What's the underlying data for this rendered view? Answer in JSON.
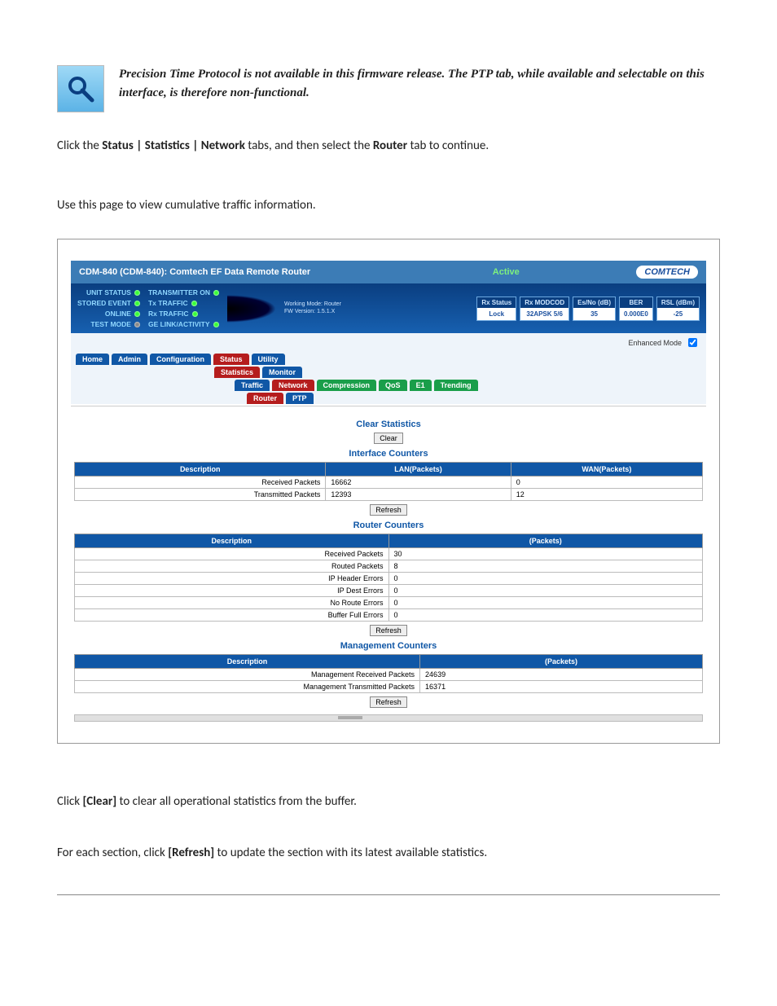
{
  "note": "Precision Time Protocol is not available in this firmware release. The PTP tab, while available and selectable on this interface, is therefore non-functional.",
  "intro1_pre": "Click the ",
  "intro1_bold": "Status | Statistics | Network",
  "intro1_mid": " tabs, and then select the ",
  "intro1_bold2": "Router",
  "intro1_post": " tab to continue.",
  "intro2": "Use this page to view cumulative traffic information.",
  "outro1_pre": "Click ",
  "outro1_bold": "[Clear]",
  "outro1_post": " to clear all operational statistics from the buffer.",
  "outro2_pre": "For each section, click ",
  "outro2_bold": "[Refresh]",
  "outro2_post": " to update the section with its latest available statistics.",
  "ss": {
    "title": "CDM-840 (CDM-840): Comtech EF Data Remote Router",
    "active": "Active",
    "brand": "COMTECH",
    "status_left": [
      {
        "label": "UNIT STATUS"
      },
      {
        "label": "STORED EVENT"
      },
      {
        "label": "ONLINE"
      },
      {
        "label": "TEST MODE"
      }
    ],
    "status_right": [
      {
        "label": "TRANSMITTER ON"
      },
      {
        "label": "Tx TRAFFIC"
      },
      {
        "label": "Rx TRAFFIC"
      },
      {
        "label": "GE LINK/ACTIVITY"
      }
    ],
    "wm1": "Working Mode: Router",
    "wm2": "FW Version: 1.5.1.X",
    "rx": [
      {
        "hdr": "Rx Status",
        "val": "Lock"
      },
      {
        "hdr": "Rx MODCOD",
        "val": "32APSK 5/6"
      },
      {
        "hdr": "Es/No (dB)",
        "val": "35"
      },
      {
        "hdr": "BER",
        "val": "0.000E0"
      },
      {
        "hdr": "RSL (dBm)",
        "val": "-25"
      }
    ],
    "enhanced": "Enhanced Mode",
    "nav1": [
      "Home",
      "Admin",
      "Configuration",
      "Status",
      "Utility"
    ],
    "nav1_sel": "Status",
    "nav2": [
      "Statistics",
      "Monitor"
    ],
    "nav2_sel": "Statistics",
    "nav3": [
      "Traffic",
      "Network",
      "Compression",
      "QoS",
      "E1",
      "Trending"
    ],
    "nav3_sel": "Network",
    "nav4": [
      "Router",
      "PTP"
    ],
    "nav4_sel": "Router",
    "sec_clear": "Clear Statistics",
    "btn_clear": "Clear",
    "sec_if": "Interface Counters",
    "if_headers": [
      "Description",
      "LAN(Packets)",
      "WAN(Packets)"
    ],
    "if_rows": [
      {
        "d": "Received Packets",
        "l": "16662",
        "w": "0"
      },
      {
        "d": "Transmitted Packets",
        "l": "12393",
        "w": "12"
      }
    ],
    "btn_refresh": "Refresh",
    "sec_router": "Router Counters",
    "rc_headers": [
      "Description",
      "(Packets)"
    ],
    "rc_rows": [
      {
        "d": "Received Packets",
        "v": "30"
      },
      {
        "d": "Routed Packets",
        "v": "8"
      },
      {
        "d": "IP Header Errors",
        "v": "0"
      },
      {
        "d": "IP Dest Errors",
        "v": "0"
      },
      {
        "d": "No Route Errors",
        "v": "0"
      },
      {
        "d": "Buffer Full Errors",
        "v": "0"
      }
    ],
    "sec_mgmt": "Management Counters",
    "mc_headers": [
      "Description",
      "(Packets)"
    ],
    "mc_rows": [
      {
        "d": "Management Received Packets",
        "v": "24639"
      },
      {
        "d": "Management Transmitted Packets",
        "v": "16371"
      }
    ]
  }
}
